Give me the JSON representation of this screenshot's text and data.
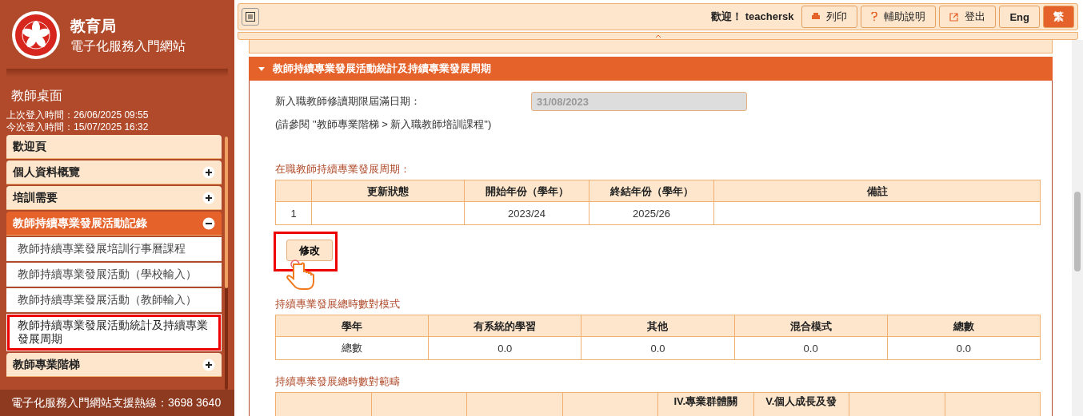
{
  "portal": {
    "department": "教育局",
    "name": "電子化服務入門網站"
  },
  "desk": {
    "title": "教師桌面",
    "last_login": "上次登入時間：26/06/2025 09:55",
    "this_login": "今次登入時間：15/07/2025 16:32"
  },
  "menu": [
    {
      "label": "歡迎頁",
      "kind": "link",
      "expanded": false
    },
    {
      "label": "個人資料概覽",
      "kind": "group",
      "expanded": false
    },
    {
      "label": "培訓需要",
      "kind": "group",
      "expanded": false
    },
    {
      "label": "教師持續專業發展活動記錄",
      "kind": "group",
      "expanded": true,
      "children": [
        {
          "label": "教師持續專業發展培訓行事曆課程",
          "selected": false,
          "highlighted": false
        },
        {
          "label": "教師持續專業發展活動（學校輸入）",
          "selected": false,
          "highlighted": false
        },
        {
          "label": "教師持續專業發展活動（教師輸入）",
          "selected": false,
          "highlighted": false
        },
        {
          "label": "教師持續專業發展活動統計及持續專業發展周期",
          "selected": true,
          "highlighted": true
        }
      ]
    },
    {
      "label": "教師專業階梯",
      "kind": "group",
      "expanded": false
    }
  ],
  "hotline": "電子化服務入門網站支援熱線：3698 3640",
  "topbar": {
    "welcome": "歡迎！",
    "user": "teachersk",
    "buttons": [
      {
        "label": "列印",
        "kind": "print",
        "selected": false
      },
      {
        "label": "輔助說明",
        "kind": "help",
        "selected": false
      },
      {
        "label": "登出",
        "kind": "logout",
        "selected": false
      },
      {
        "label": "Eng",
        "kind": "lang",
        "selected": false
      },
      {
        "label": "繁",
        "kind": "lang",
        "selected": true
      }
    ]
  },
  "section": {
    "title": "教師持續專業發展活動統計及持續專業發展周期",
    "expanded": true,
    "expiry_label": "新入職教師修讀期限屆滿日期：",
    "expiry_value": "31/08/2023",
    "note": "(請參閱 \"教師專業階梯 > 新入職教師培訓課程\")",
    "cycle": {
      "title": "在職教師持續專業發展周期：",
      "columns": [
        "",
        "更新狀態",
        "開始年份（學年）",
        "終結年份（學年）",
        "備註"
      ],
      "rows": [
        [
          "1",
          "",
          "2023/24",
          "2025/26",
          ""
        ]
      ]
    },
    "edit_button": {
      "label": "修改",
      "highlighted": true
    },
    "mode": {
      "title": "持續專業發展總時數對模式",
      "columns": [
        "學年",
        "有系統的學習",
        "其他",
        "混合模式",
        "總數"
      ],
      "rows": [
        [
          "總數",
          "0.0",
          "0.0",
          "0.0",
          "0.0"
        ]
      ]
    },
    "domain": {
      "title": "持續專業發展總時數對範疇",
      "columns": [
        "",
        "",
        "",
        "",
        "IV.專業群體關",
        "V.個人成長及發",
        "",
        ""
      ]
    }
  }
}
